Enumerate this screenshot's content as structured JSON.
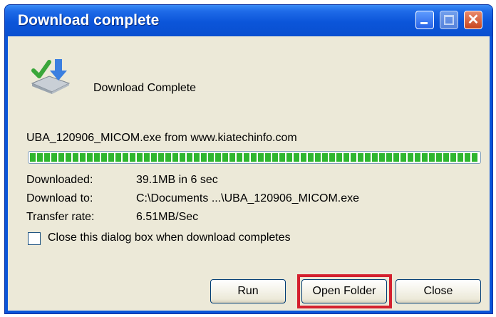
{
  "window": {
    "title": "Download complete"
  },
  "header": {
    "icon": "download-complete-icon",
    "text": "Download Complete"
  },
  "download": {
    "file_and_source": "UBA_120906_MICOM.exe from www.kiatechinfo.com",
    "progress_fraction": 1.0,
    "rows": [
      {
        "label": "Downloaded:",
        "value": "39.1MB in 6 sec"
      },
      {
        "label": "Download to:",
        "value": "C:\\Documents ...\\UBA_120906_MICOM.exe"
      },
      {
        "label": "Transfer rate:",
        "value": "6.51MB/Sec"
      }
    ]
  },
  "options": {
    "close_on_complete_label": "Close this dialog box when download completes",
    "close_on_complete_checked": false
  },
  "buttons": {
    "run": "Run",
    "open_folder": "Open Folder",
    "close": "Close"
  },
  "colors": {
    "title_bar": "#0a55d8",
    "progress": "#2fb62f",
    "highlight": "#d4202e",
    "client_bg": "#ece9d8"
  }
}
